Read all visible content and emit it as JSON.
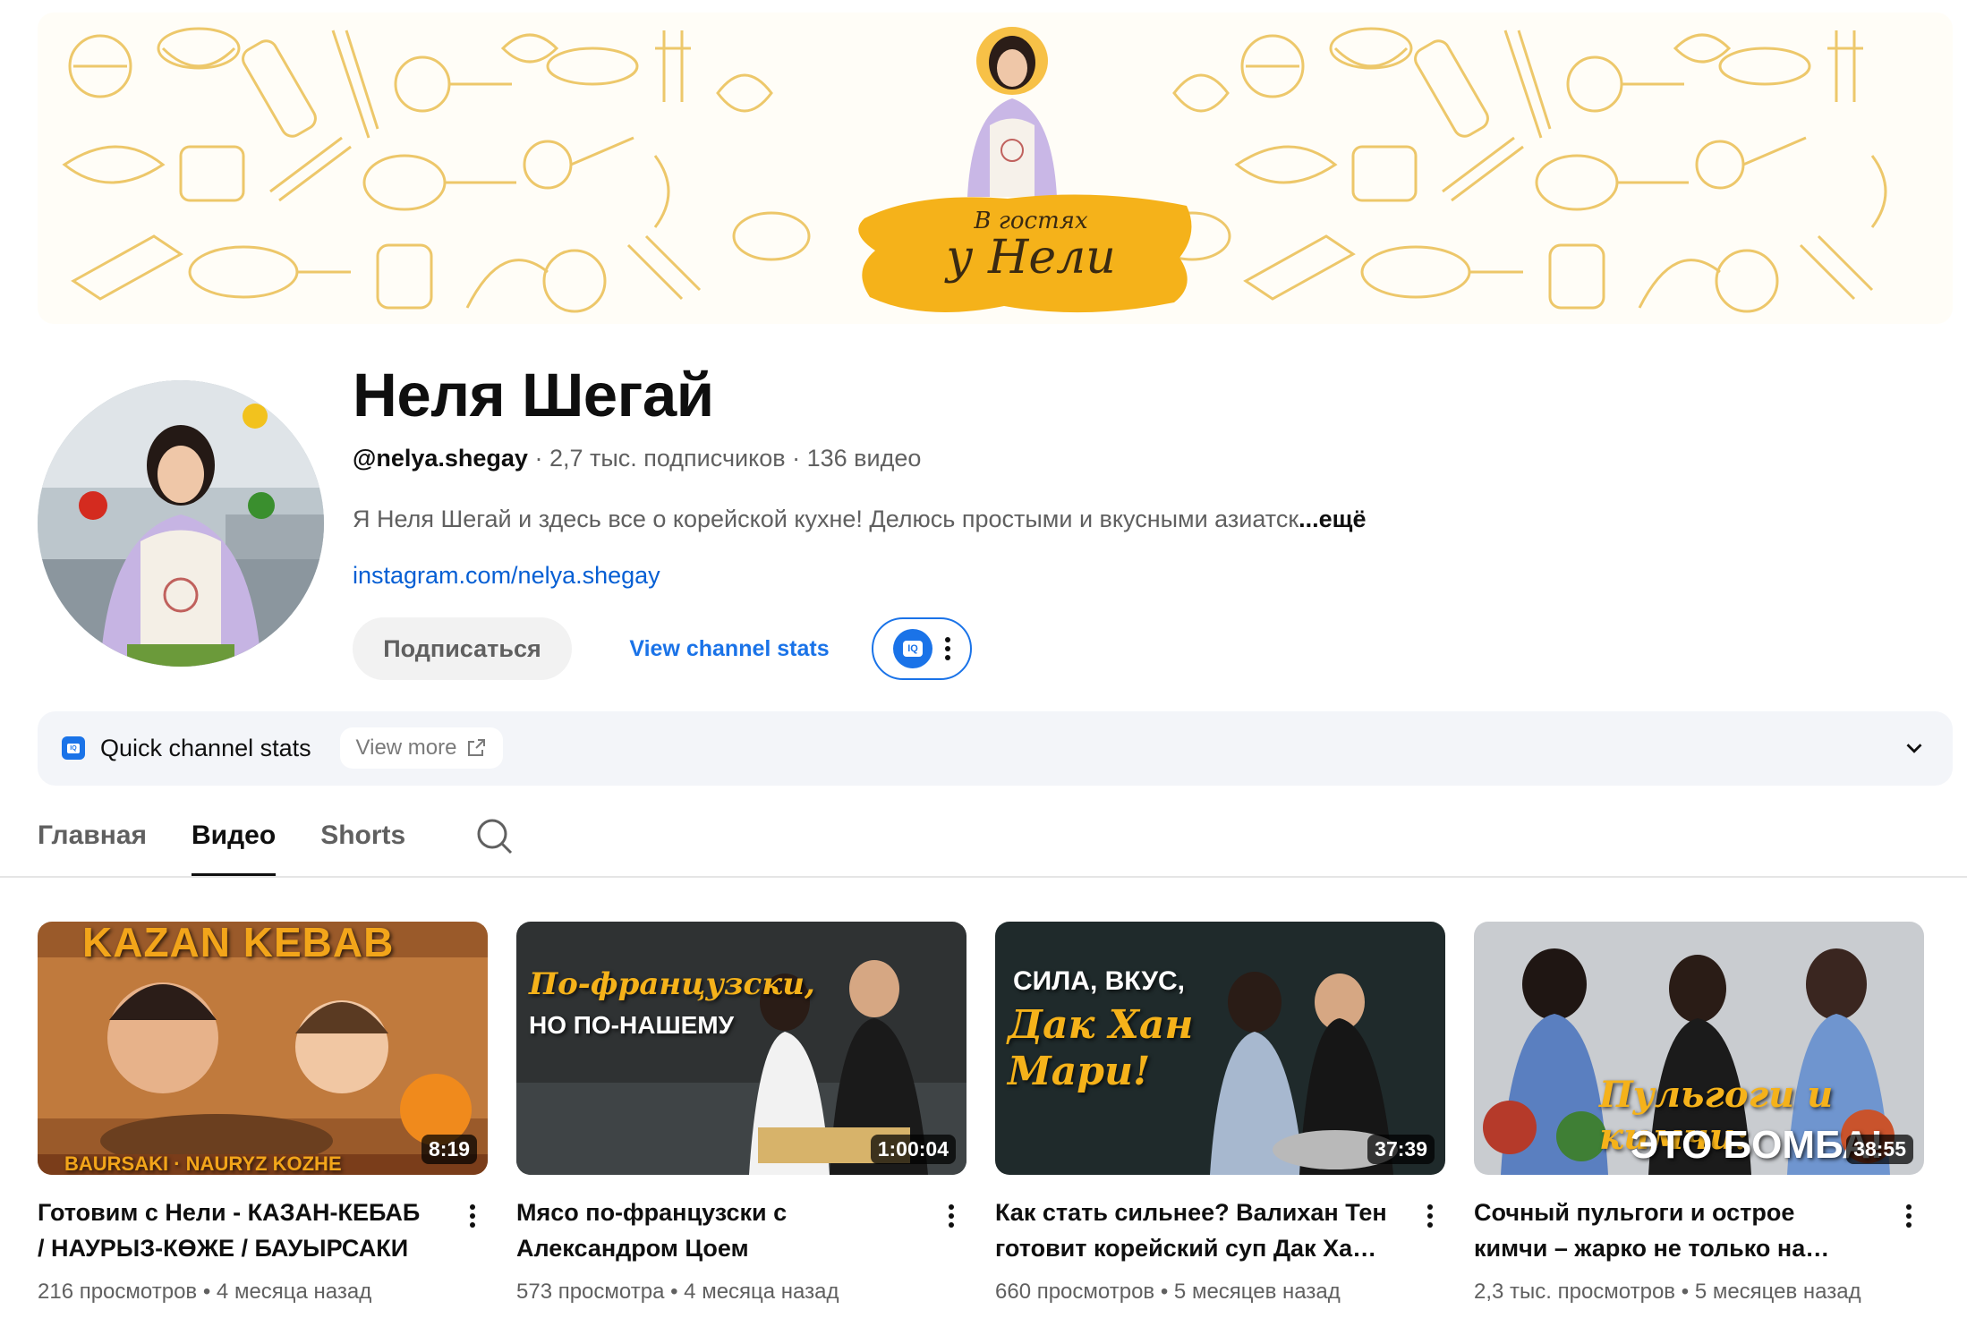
{
  "banner": {
    "script_line1": "В гостях",
    "script_line2": "у Нели",
    "accent_color": "#f5b21a"
  },
  "channel": {
    "name": "Неля Шегай",
    "handle": "@nelya.shegay",
    "subscribers": "2,7 тыс. подписчиков",
    "video_count": "136 видео",
    "separator": "·",
    "description": "Я Неля Шегай и здесь все о корейской кухне! Делюсь простыми и вкусными азиатск",
    "more_label": "...ещё",
    "link": "instagram.com/nelya.shegay"
  },
  "actions": {
    "subscribe_label": "Подписаться",
    "stats_label": "View channel stats",
    "iq_icon": "IQ"
  },
  "quick_stats": {
    "label": "Quick channel stats",
    "view_more": "View more"
  },
  "tabs": [
    {
      "label": "Главная",
      "active": false
    },
    {
      "label": "Видео",
      "active": true
    },
    {
      "label": "Shorts",
      "active": false
    }
  ],
  "videos": [
    {
      "title": "Готовим с Нели - КАЗАН-КЕБАБ / НАУРЫЗ-КӨЖЕ / БАУЫРСАКИ",
      "views": "216 просмотров",
      "age": "4 месяца назад",
      "duration": "8:19",
      "thumb_text_top": "KAZAN KEBAB",
      "thumb_text_bottom": "BAURSAKI · NAURYZ KOZHE"
    },
    {
      "title": "Мясо по-французски с Александром Цоем",
      "views": "573 просмотра",
      "age": "4 месяца назад",
      "duration": "1:00:04",
      "thumb_text_top": "По-французски,",
      "thumb_text_bottom": "НО ПО-НАШЕМУ"
    },
    {
      "title": "Как стать сильнее? Валихан Тен готовит корейский суп Дак Хан Мари",
      "views": "660 просмотров",
      "age": "5 месяцев назад",
      "duration": "37:39",
      "thumb_text_top": "СИЛА, ВКУС,",
      "thumb_text_bottom": "Дак Хан Мари!"
    },
    {
      "title": "Сочный пульгоги и острое кимчи – жарко не только на кухне!",
      "views": "2,3 тыс. просмотров",
      "age": "5 месяцев назад",
      "duration": "38:55",
      "thumb_text_top": "Пульгоги и кимчи:",
      "thumb_text_bottom": "ЭТО БОМБА!"
    }
  ],
  "meta_dot": "•"
}
